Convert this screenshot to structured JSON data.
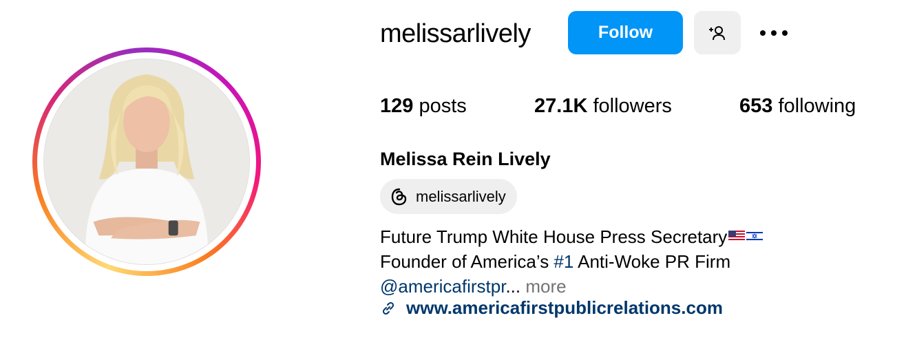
{
  "profile": {
    "username": "melissarlively",
    "full_name": "Melissa Rein Lively",
    "threads_handle": "melissarlively"
  },
  "actions": {
    "follow_label": "Follow",
    "suggest_icon": "person-add-icon",
    "more_icon": "more-horizontal-icon"
  },
  "stats": {
    "posts": {
      "count": "129",
      "label": "posts"
    },
    "followers": {
      "count": "27.1K",
      "label": "followers"
    },
    "following": {
      "count": "653",
      "label": "following"
    }
  },
  "bio": {
    "line1": "Future Trump White House Press Secretary",
    "line1_flags": [
      "us-flag",
      "israel-flag"
    ],
    "line2_prefix": "Founder of America’s ",
    "line2_hashtag": "#1",
    "line2_suffix": " Anti-Woke PR Firm",
    "line3_mention": "@americafirstpr",
    "line3_ellipsis": "...",
    "more_label": "more"
  },
  "link": {
    "icon": "link-icon",
    "url_text": "www.americafirstpublicrelations.com"
  },
  "colors": {
    "follow_button": "#0095f6",
    "link_blue": "#00376b",
    "muted": "#737373",
    "secondary_button": "#efefef"
  }
}
